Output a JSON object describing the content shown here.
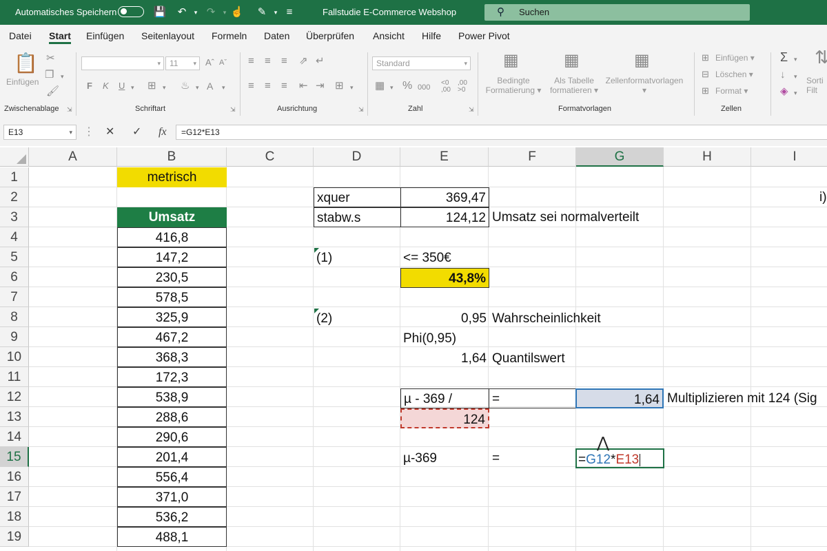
{
  "titlebar": {
    "autosave_label": "Automatisches Speichern",
    "doc_title": "Fallstudie E-Commerce Webshop",
    "search_placeholder": "Suchen"
  },
  "menu": {
    "tabs": [
      "Datei",
      "Start",
      "Einfügen",
      "Seitenlayout",
      "Formeln",
      "Daten",
      "Überprüfen",
      "Ansicht",
      "Hilfe",
      "Power Pivot"
    ],
    "active": "Start"
  },
  "ribbon": {
    "paste_label": "Einfügen",
    "group_clipboard": "Zwischenablage",
    "group_font": "Schriftart",
    "group_align": "Ausrichtung",
    "group_number": "Zahl",
    "group_styles": "Formatvorlagen",
    "group_cells": "Zellen",
    "font_size": "11",
    "number_format": "Standard",
    "bold": "F",
    "italic": "K",
    "underline": "U",
    "cond_format_l1": "Bedingte",
    "cond_format_l2": "Formatierung",
    "as_table_l1": "Als Tabelle",
    "as_table_l2": "formatieren",
    "cell_styles": "Zellenformatvorlagen",
    "insert": "Einfügen",
    "delete": "Löschen",
    "format": "Format",
    "sort_l1": "Sorti",
    "sort_l2": "Filt"
  },
  "formula_bar": {
    "name_box": "E13",
    "formula": "=G12*E13"
  },
  "columns": [
    "A",
    "B",
    "C",
    "D",
    "E",
    "F",
    "G",
    "H",
    "I"
  ],
  "rows": [
    "1",
    "2",
    "3",
    "4",
    "5",
    "6",
    "7",
    "8",
    "9",
    "10",
    "11",
    "12",
    "13",
    "14",
    "15",
    "16",
    "17",
    "18",
    "19"
  ],
  "cells": {
    "B1": "metrisch",
    "B3": "Umsatz",
    "B_values": [
      "416,8",
      "147,2",
      "230,5",
      "578,5",
      "325,9",
      "467,2",
      "368,3",
      "172,3",
      "538,9",
      "288,6",
      "290,6",
      "201,4",
      "556,4",
      "371,0",
      "536,2",
      "488,1"
    ],
    "D2": "xquer",
    "E2": "369,47",
    "D3": "stabw.s",
    "E3": "124,12",
    "F3": "Umsatz sei normalverteilt",
    "D5": "(1)",
    "E5": "<= 350€",
    "E6": "43,8%",
    "D8": "(2)",
    "E8": "0,95",
    "F8": "Wahrscheinlichkeit",
    "E9": "Phi(0,95)",
    "E10": "1,64",
    "F10": "Quantilswert",
    "E12": "µ - 369 /",
    "F12": "=",
    "G12": "1,64",
    "H12": "Multiplizieren mit 124 (Sig",
    "E13": "124",
    "E15": "µ-369",
    "F15": "=",
    "G15_eq": "=",
    "G15_ref1": "G12",
    "G15_op": "*",
    "G15_ref2": "E13",
    "I2": "i)"
  },
  "colors": {
    "brand_green": "#1e7145",
    "yellow": "#f2dc00",
    "ref_blue": "#2e75b6",
    "ref_red": "#c0392b"
  }
}
